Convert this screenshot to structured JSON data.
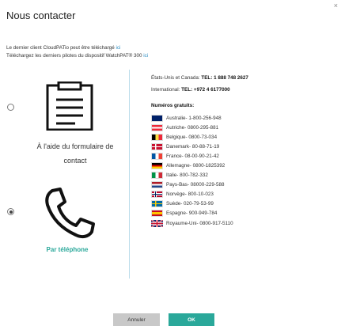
{
  "dialog": {
    "title": "Nous contacter",
    "close_glyph": "×"
  },
  "intro": {
    "line1_text": "Le dernier client CloudPATio peut être téléchargé",
    "line1_link": "ici",
    "line2_text": "Téléchargez les derniers pilotes du dispositif WatchPAT® 300",
    "line2_link": "ici"
  },
  "options": {
    "form": {
      "label": "À l'aide du formulaire de contact",
      "icon": "form-document-icon",
      "selected": false
    },
    "phone": {
      "label": "Par téléphone",
      "icon": "phone-icon",
      "selected": true
    }
  },
  "contact": {
    "us_canada_label": "États-Unis et Canada:",
    "us_canada_tel": "TEL: 1 888 748 2627",
    "intl_label": "International:",
    "intl_tel": "TEL: +972 4 6177000",
    "free_title": "Numéros gratuits:"
  },
  "countries": [
    {
      "flag": "au",
      "text": "Australie- 1-800-256-948"
    },
    {
      "flag": "at",
      "text": "Autriche- 0800-295-881"
    },
    {
      "flag": "be",
      "text": "Belgique- 0800-73-034"
    },
    {
      "flag": "dk",
      "text": "Danemark- 80-88-71-19"
    },
    {
      "flag": "fr",
      "text": "France- 08-00-90-21-42"
    },
    {
      "flag": "de",
      "text": "Allemagne- 0800-1825392"
    },
    {
      "flag": "it",
      "text": "Italie- 800-782-332"
    },
    {
      "flag": "nl",
      "text": "Pays-Bas- 08000-229-588"
    },
    {
      "flag": "no",
      "text": "Norvège- 800-10-023"
    },
    {
      "flag": "se",
      "text": "Suède- 020-79-53-99"
    },
    {
      "flag": "es",
      "text": "Espagne- 900-949-784"
    },
    {
      "flag": "gb",
      "text": "Royaume-Uni- 0800-917-5110"
    }
  ],
  "buttons": {
    "cancel": "Annuler",
    "ok": "OK"
  },
  "colors": {
    "accent": "#2aa89a",
    "link": "#2f8fc4",
    "divider": "#b9dcea"
  }
}
